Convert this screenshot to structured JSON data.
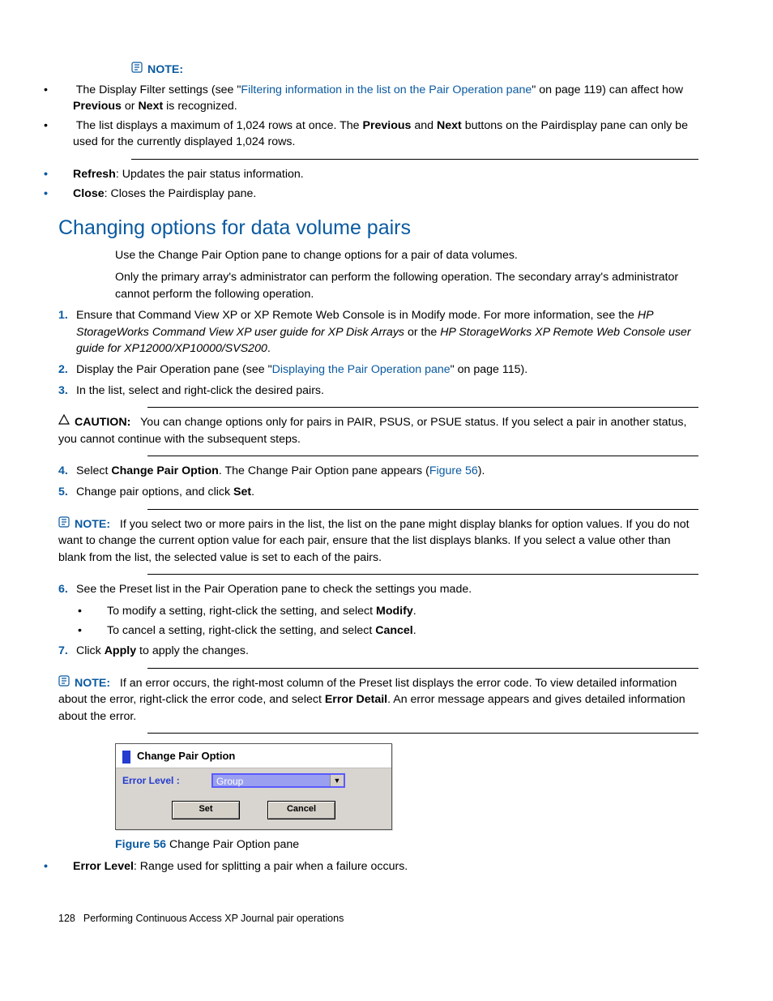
{
  "noteLabel": "NOTE:",
  "cautionLabel": "CAUTION:",
  "noteTop": {
    "b1a": "The Display Filter settings (see \"",
    "b1link": "Filtering information in the list on the Pair Operation pane",
    "b1b": "\" on page 119) can affect how ",
    "b1c": "Previous",
    "b1d": " or ",
    "b1e": "Next",
    "b1f": " is recognized.",
    "b2a": "The list displays a maximum of 1,024 rows at once. The ",
    "b2b": "Previous",
    "b2c": " and ",
    "b2d": "Next",
    "b2e": " buttons on the Pairdisplay pane can only be used for the currently displayed 1,024 rows."
  },
  "defs": {
    "refresh_t": "Refresh",
    "refresh_b": ": Updates the pair status information.",
    "close_t": "Close",
    "close_b": ": Closes the Pairdisplay pane."
  },
  "h2": "Changing options for data volume pairs",
  "intro1": "Use the Change Pair Option pane to change options for a pair of data volumes.",
  "intro2": "Only the primary array's administrator can perform the following operation. The secondary array's administrator cannot perform the following operation.",
  "step1": {
    "a": "Ensure that Command View XP or XP Remote Web Console is in Modify mode. For more information, see the ",
    "i1": "HP StorageWorks Command View XP user guide for XP Disk Arrays",
    "b": " or the ",
    "i2": "HP StorageWorks XP Remote Web Console user guide for XP12000/XP10000/SVS200",
    "c": "."
  },
  "step2": {
    "a": "Display the Pair Operation pane (see \"",
    "link": "Displaying the Pair Operation pane",
    "b": "\" on page 115)."
  },
  "step3": "In the list, select and right-click the desired pairs.",
  "caution1": "You can change options only for pairs in PAIR, PSUS, or PSUE status. If you select a pair in another status, you cannot continue with the subsequent steps.",
  "step4": {
    "a": "Select ",
    "b": "Change Pair Option",
    "c": ". The Change Pair Option pane appears (",
    "link": "Figure 56",
    "d": ")."
  },
  "step5": {
    "a": "Change pair options, and click ",
    "b": "Set",
    "c": "."
  },
  "note2": "If you select two or more pairs in the list, the list on the pane might display blanks for option values. If you do not want to change the current option value for each pair, ensure that the list displays blanks. If you select a value other than blank from the list, the selected value is set to each of the pairs.",
  "step6": {
    "a": "See the Preset list in the Pair Operation pane to check the settings you made.",
    "s1a": "To modify a setting, right-click the setting, and select ",
    "s1b": "Modify",
    "s1c": ".",
    "s2a": "To cancel a setting, right-click the setting, and select ",
    "s2b": "Cancel",
    "s2c": "."
  },
  "step7": {
    "a": "Click ",
    "b": "Apply",
    "c": " to apply the changes."
  },
  "note3": {
    "a": "If an error occurs, the right-most column of the Preset list displays the error code. To view detailed information about the error, right-click the error code, and select ",
    "b": "Error Detail",
    "c": ". An error message appears and gives detailed information about the error."
  },
  "dialog": {
    "title": "Change Pair Option",
    "errorLevelLabel": "Error Level :",
    "dropdownValue": "Group",
    "setBtn": "Set",
    "cancelBtn": "Cancel"
  },
  "figCaption": {
    "num": "Figure 56",
    "text": " Change Pair Option pane"
  },
  "errLevel": {
    "t": "Error Level",
    "b": ": Range used for splitting a pair when a failure occurs."
  },
  "footer": {
    "page": "128",
    "chapter": "Performing Continuous Access XP Journal pair operations"
  }
}
